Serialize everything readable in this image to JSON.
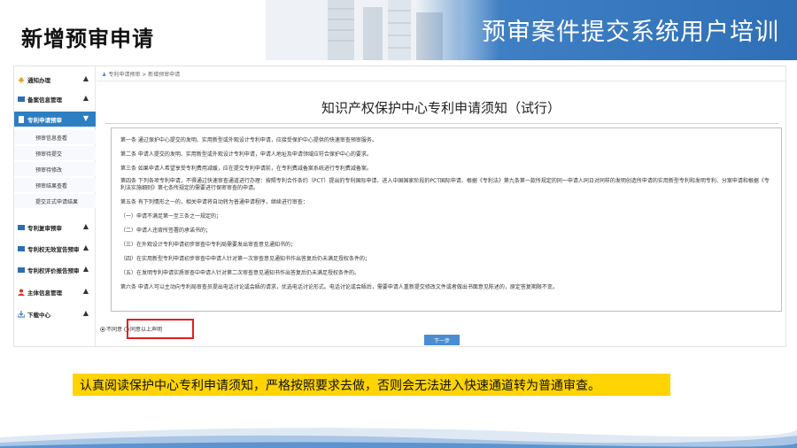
{
  "header": {
    "title": "新增预审申请",
    "subtitle": "预审案件提交系统用户培训",
    "brand_blue": "#2f6fb6"
  },
  "sidebar": {
    "items": [
      {
        "label": "通知办理",
        "icon": "bell-icon",
        "icon_color": "#e8a020"
      },
      {
        "label": "备案信息管理",
        "icon": "folder-icon",
        "icon_color": "#2e6db4"
      },
      {
        "label": "专利申请预审",
        "icon": "document-icon",
        "icon_color": "#ffffff"
      },
      {
        "label": "专利复审预审",
        "icon": "folder-icon",
        "icon_color": "#2e6db4"
      },
      {
        "label": "专利权无效宣告预审",
        "icon": "folder-icon",
        "icon_color": "#2e6db4"
      },
      {
        "label": "专利权评价报告预审",
        "icon": "folder-icon",
        "icon_color": "#2e6db4"
      },
      {
        "label": "主体信息管理",
        "icon": "user-icon",
        "icon_color": "#d8322a"
      },
      {
        "label": "下载中心",
        "icon": "download-icon",
        "icon_color": "#2e6db4"
      }
    ],
    "subitems": [
      "预审信息查看",
      "预审待提交",
      "预审待修改",
      "预审结果查看",
      "提交正式申请结果"
    ],
    "active_color": "#2e7fc2"
  },
  "breadcrumb": "专利申请预审 > 新增预审申请",
  "doc": {
    "title": "知识产权保护中心专利申请须知（试行）",
    "lines": [
      "第一条 通过保护中心提交的发明、实用新型或外观设计专利申请，应接受保护中心提供的快速审查预审服务。",
      "第二条 申请人提交的发明、实用新型或外观设计专利申请，申请人地址及申请领域应符合保护中心的要求。",
      "第三条 如果申请人希望享受专利费用减缓，应在提交专利申请前，在专利费减备案系统进行专利费减备案。",
      "第四条 下列各项专利申请，不得通过快速审查通道进行办理：按照专利合作条约（PCT）提出的专利国际申请、进入中国国家阶段的PCT国际申请、根据《专利法》第九条第一款所规定的同一申请人同日对同样的发明创造所申请的实用新型专利和发明专利、分案申请和根据《专利法实施细则》第七条所规定的需要进行保密审查的申请。",
      "第五条 有下列情形之一的，相关申请将自动转为普通申请程序，继续进行审查：",
      "（一）申请不满足第一至三条之一规定的；",
      "（二）申请人违背所签署的承诺书的；",
      "（三）在外观设计专利申请初步审查中专利局需要发出审查意见通知书的；",
      "（四）在实用新型专利申请初步审查中申请人针对第一次审查意见通知书作出答复后仍未满足授权条件的；",
      "（五）在发明专利申请实质审查中申请人针对第二次审查意见通知书作出答复后仍未满足授权条件的。",
      "第六条 申请人可以主动向专利局审查员提出电话讨论或会晤的请求，优选电话讨论形式。电话讨论或会晤后，需要申请人重新提交修改文件或者做出书面意见陈述的，原定答复期限不变。"
    ]
  },
  "agree": {
    "disagree_label": "不同意",
    "agree_label": "同意以上声明",
    "selected": "disagree"
  },
  "next_button": "下一步",
  "note": "认真阅读保护中心专利申请须知，严格按照要求去做，否则会无法进入快速通道转为普通审查。",
  "highlight_color": "#ffd400",
  "callout_color": "#e0201e"
}
